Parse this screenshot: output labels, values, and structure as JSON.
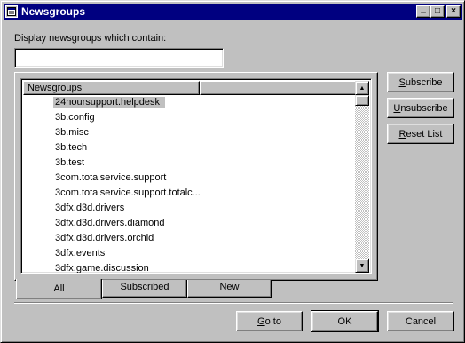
{
  "window": {
    "title": "Newsgroups",
    "title_icon": "newsgroups-app-icon",
    "controls": {
      "minimize": "_",
      "maximize": "□",
      "close": "×"
    }
  },
  "filter": {
    "label": "Display newsgroups which contain:",
    "value": ""
  },
  "list": {
    "columns": [
      "Newsgroups",
      ""
    ],
    "items": [
      "24hoursupport.helpdesk",
      "3b.config",
      "3b.misc",
      "3b.tech",
      "3b.test",
      "3com.totalservice.support",
      "3com.totalservice.support.totalc...",
      "3dfx.d3d.drivers",
      "3dfx.d3d.drivers.diamond",
      "3dfx.d3d.drivers.orchid",
      "3dfx.events",
      "3dfx.game.discussion"
    ],
    "selected_index": 0,
    "scroll_up_icon": "▲",
    "scroll_down_icon": "▼"
  },
  "tabs": [
    "All",
    "Subscribed",
    "New"
  ],
  "active_tab": "All",
  "side_buttons": {
    "subscribe": {
      "first": "S",
      "rest": "ubscribe"
    },
    "unsubscribe": {
      "first": "U",
      "rest": "nsubscribe"
    },
    "reset_list": {
      "first": "R",
      "rest": "eset List"
    }
  },
  "bottom_buttons": {
    "goto": {
      "first": "G",
      "rest": "o to"
    },
    "ok": "OK",
    "cancel": "Cancel"
  },
  "colors": {
    "face": "#c0c0c0",
    "titlebar": "#000080",
    "selection": "#c0c0c0"
  }
}
